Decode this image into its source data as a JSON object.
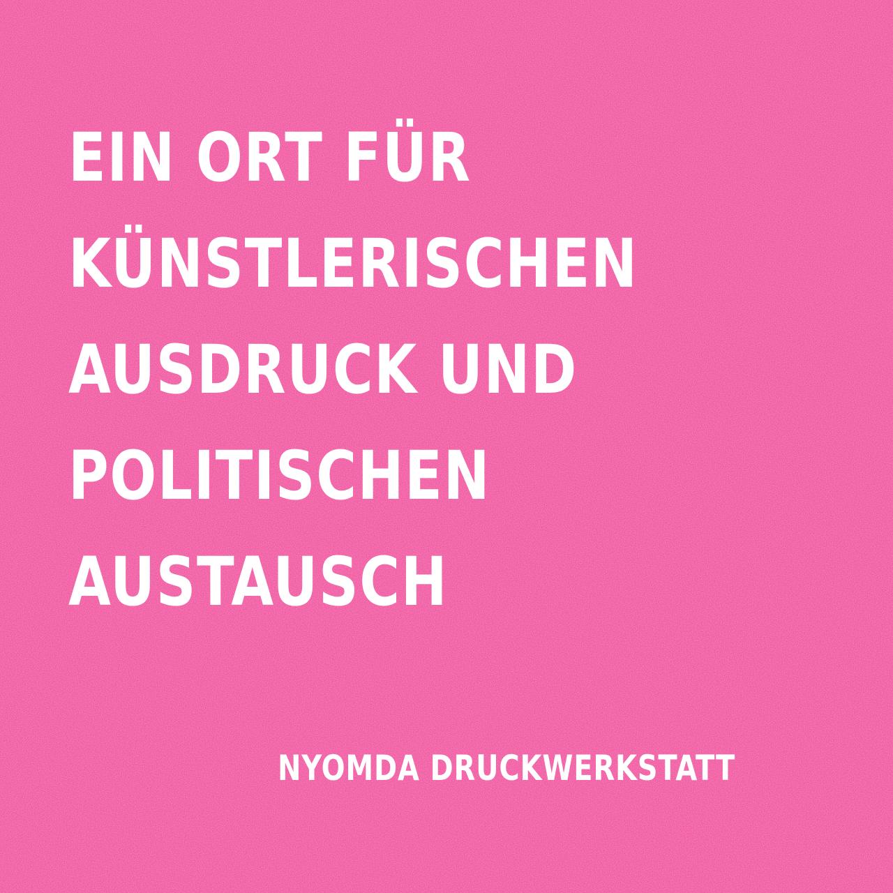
{
  "poster": {
    "background_color": "#f0509a",
    "text_color": "#ffffff",
    "headline_lines": [
      "EIN ORT FÜR",
      "KÜNSTLERISCHEN",
      "AUSDRUCK UND",
      "POLITISCHEN",
      "AUSTAUSCH"
    ],
    "signature": "NYOMDA DRUCKWERKSTATT"
  }
}
